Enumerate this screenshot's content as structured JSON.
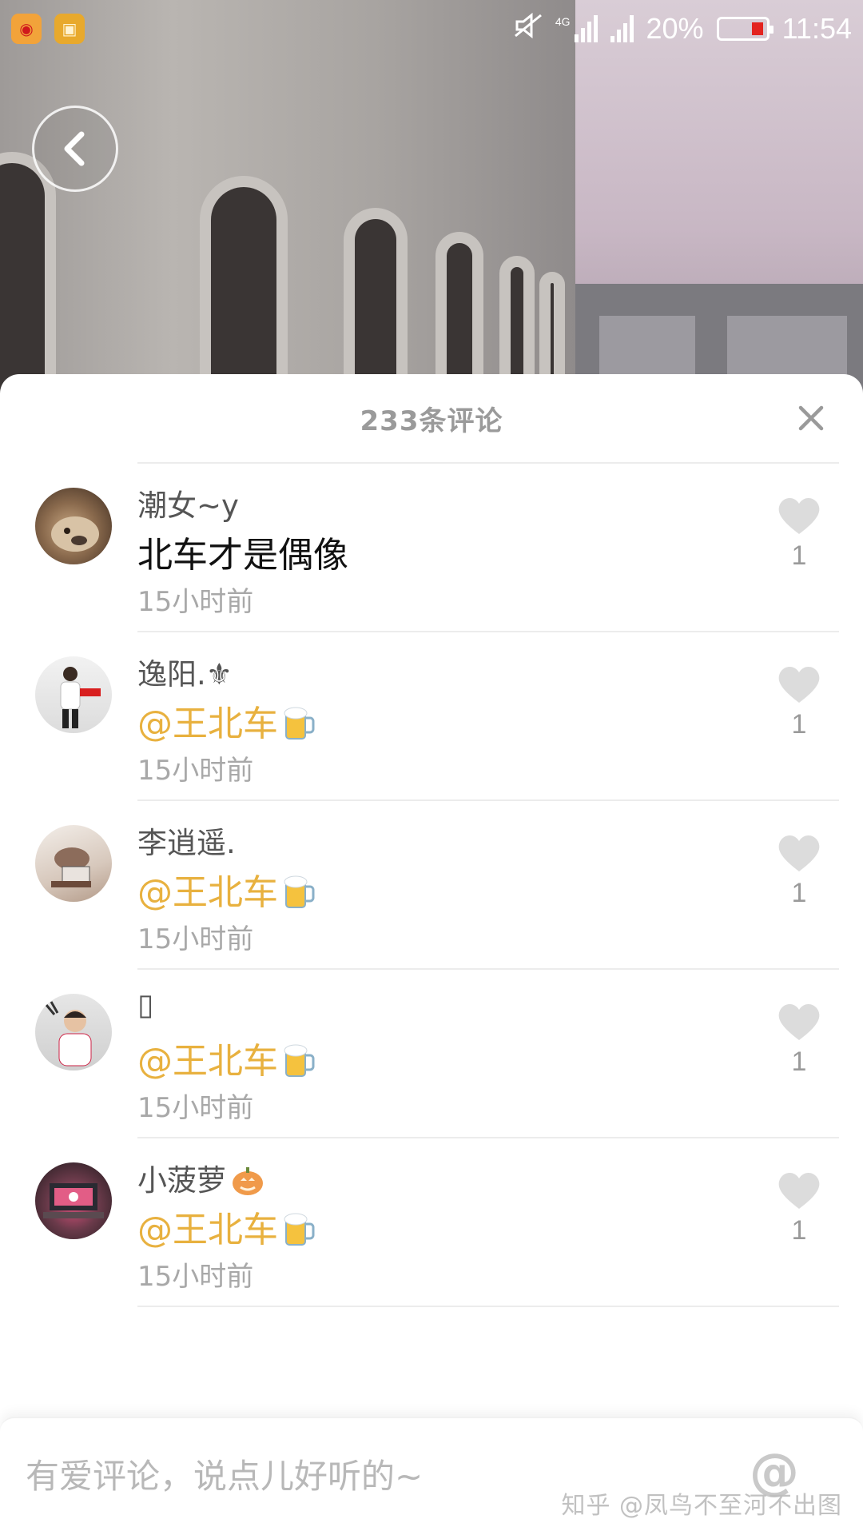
{
  "status_bar": {
    "battery_percent": "20%",
    "time": "11:54",
    "network": "4G",
    "notification_icons": [
      "weibo-icon",
      "app-notification-icon"
    ],
    "battery_level": 0.2,
    "battery_color": "#e3231f"
  },
  "sheet": {
    "title": "233条评论"
  },
  "comments": [
    {
      "username": "潮女~y",
      "content": "北车才是偶像",
      "is_mention": false,
      "time": "15小时前",
      "likes": "1"
    },
    {
      "username": "逸阳.⚜",
      "content": "@王北车",
      "is_mention": true,
      "time": "15小时前",
      "likes": "1"
    },
    {
      "username": "李逍遥.",
      "content": "@王北车",
      "is_mention": true,
      "time": "15小时前",
      "likes": "1"
    },
    {
      "username": "▯",
      "content": "@王北车",
      "is_mention": true,
      "time": "15小时前",
      "likes": "1"
    },
    {
      "username": "小菠萝",
      "content": "@王北车",
      "is_mention": true,
      "time": "15小时前",
      "likes": "1"
    }
  ],
  "input": {
    "placeholder": "有爱评论，说点儿好听的~",
    "value": "",
    "at_label": "@"
  },
  "watermark": "知乎 @凤鸟不至河不出图",
  "colors": {
    "mention": "#e8b13f",
    "heart": "#dcdcdc",
    "muted": "#9a9a9a"
  }
}
